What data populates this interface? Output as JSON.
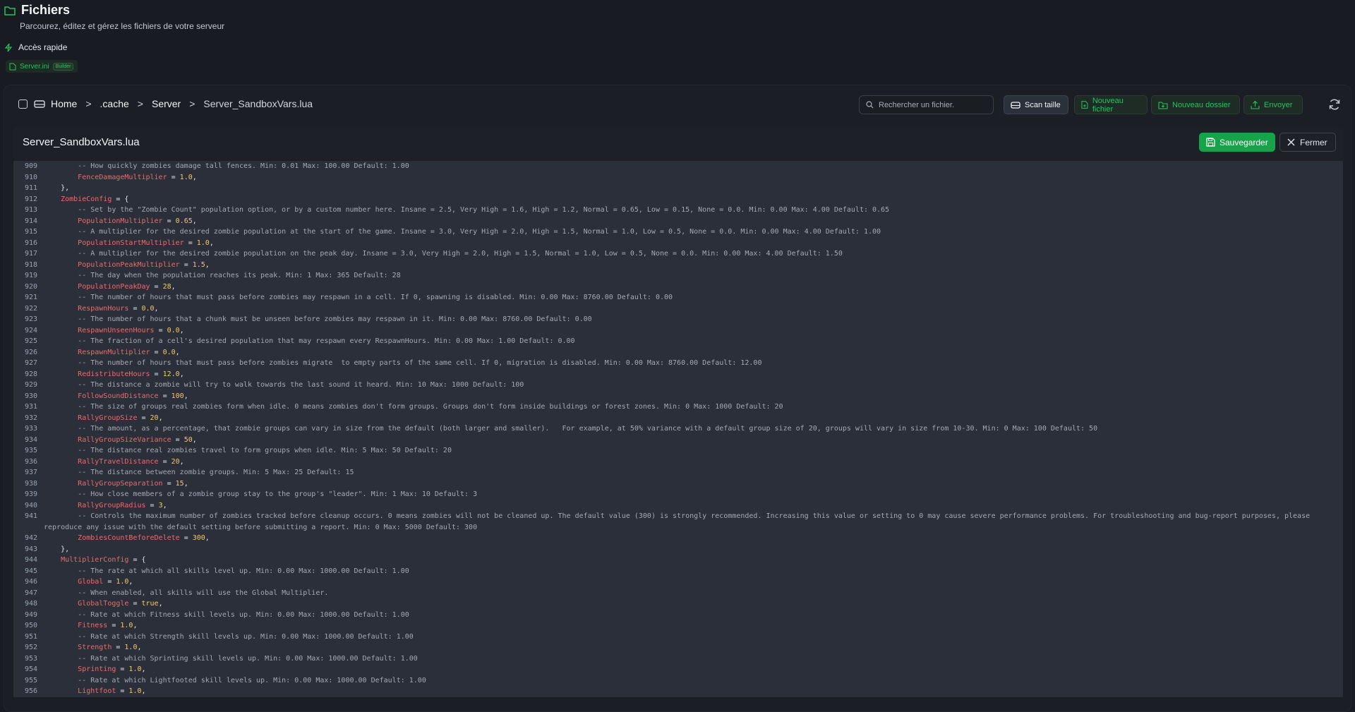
{
  "header": {
    "title": "Fichiers",
    "subtitle": "Parcourez, éditez et gérez les fichiers de votre serveur",
    "quick_access_label": "Accès rapide",
    "quick_chip": {
      "label": "Server.ini",
      "tag": "Builder"
    }
  },
  "breadcrumb": [
    "Home",
    ".cache",
    "Server",
    "Server_SandboxVars.lua"
  ],
  "breadcrumb_sep": ">",
  "search": {
    "placeholder": "Rechercher un fichier."
  },
  "toolbar": {
    "scan_label": "Scan taille",
    "new_file_label": "Nouveau fichier",
    "new_folder_label": "Nouveau dossier",
    "upload_label": "Envoyer"
  },
  "editor": {
    "filename": "Server_SandboxVars.lua",
    "save_label": "Sauvegarder",
    "close_label": "Fermer"
  },
  "colors": {
    "accent": "#22c55e",
    "save": "#16a34a",
    "key": "#ef6a6a",
    "number": "#f3c969"
  },
  "code_lines": [
    {
      "n": "909",
      "t": "comment",
      "indent": 8,
      "text": "-- How quickly zombies damage tall fences. Min: 0.01 Max: 100.00 Default: 1.00"
    },
    {
      "n": "910",
      "t": "assign",
      "indent": 8,
      "key": "FenceDamageMultiplier",
      "val": "1.0"
    },
    {
      "n": "911",
      "t": "plain",
      "indent": 4,
      "text": "},"
    },
    {
      "n": "912",
      "t": "open",
      "indent": 4,
      "key": "ZombieConfig"
    },
    {
      "n": "913",
      "t": "comment",
      "indent": 8,
      "text": "-- Set by the \"Zombie Count\" population option, or by a custom number here. Insane = 2.5, Very High = 1.6, High = 1.2, Normal = 0.65, Low = 0.15, None = 0.0. Min: 0.00 Max: 4.00 Default: 0.65"
    },
    {
      "n": "914",
      "t": "assign",
      "indent": 8,
      "key": "PopulationMultiplier",
      "val": "0.65"
    },
    {
      "n": "915",
      "t": "comment",
      "indent": 8,
      "text": "-- A multiplier for the desired zombie population at the start of the game. Insane = 3.0, Very High = 2.0, High = 1.5, Normal = 1.0, Low = 0.5, None = 0.0. Min: 0.00 Max: 4.00 Default: 1.00"
    },
    {
      "n": "916",
      "t": "assign",
      "indent": 8,
      "key": "PopulationStartMultiplier",
      "val": "1.0"
    },
    {
      "n": "917",
      "t": "comment",
      "indent": 8,
      "text": "-- A multiplier for the desired zombie population on the peak day. Insane = 3.0, Very High = 2.0, High = 1.5, Normal = 1.0, Low = 0.5, None = 0.0. Min: 0.00 Max: 4.00 Default: 1.50"
    },
    {
      "n": "918",
      "t": "assign",
      "indent": 8,
      "key": "PopulationPeakMultiplier",
      "val": "1.5"
    },
    {
      "n": "919",
      "t": "comment",
      "indent": 8,
      "text": "-- The day when the population reaches its peak. Min: 1 Max: 365 Default: 28"
    },
    {
      "n": "920",
      "t": "assign",
      "indent": 8,
      "key": "PopulationPeakDay",
      "val": "28"
    },
    {
      "n": "921",
      "t": "comment",
      "indent": 8,
      "text": "-- The number of hours that must pass before zombies may respawn in a cell. If 0, spawning is disabled. Min: 0.00 Max: 8760.00 Default: 0.00"
    },
    {
      "n": "922",
      "t": "assign",
      "indent": 8,
      "key": "RespawnHours",
      "val": "0.0"
    },
    {
      "n": "923",
      "t": "comment",
      "indent": 8,
      "text": "-- The number of hours that a chunk must be unseen before zombies may respawn in it. Min: 0.00 Max: 8760.00 Default: 0.00"
    },
    {
      "n": "924",
      "t": "assign",
      "indent": 8,
      "key": "RespawnUnseenHours",
      "val": "0.0"
    },
    {
      "n": "925",
      "t": "comment",
      "indent": 8,
      "text": "-- The fraction of a cell's desired population that may respawn every RespawnHours. Min: 0.00 Max: 1.00 Default: 0.00"
    },
    {
      "n": "926",
      "t": "assign",
      "indent": 8,
      "key": "RespawnMultiplier",
      "val": "0.0"
    },
    {
      "n": "927",
      "t": "comment",
      "indent": 8,
      "text": "-- The number of hours that must pass before zombies migrate  to empty parts of the same cell. If 0, migration is disabled. Min: 0.00 Max: 8760.00 Default: 12.00"
    },
    {
      "n": "928",
      "t": "assign",
      "indent": 8,
      "key": "RedistributeHours",
      "val": "12.0"
    },
    {
      "n": "929",
      "t": "comment",
      "indent": 8,
      "text": "-- The distance a zombie will try to walk towards the last sound it heard. Min: 10 Max: 1000 Default: 100"
    },
    {
      "n": "930",
      "t": "assign",
      "indent": 8,
      "key": "FollowSoundDistance",
      "val": "100"
    },
    {
      "n": "931",
      "t": "comment",
      "indent": 8,
      "text": "-- The size of groups real zombies form when idle. 0 means zombies don't form groups. Groups don't form inside buildings or forest zones. Min: 0 Max: 1000 Default: 20"
    },
    {
      "n": "932",
      "t": "assign",
      "indent": 8,
      "key": "RallyGroupSize",
      "val": "20"
    },
    {
      "n": "933",
      "t": "comment",
      "indent": 8,
      "text": "-- The amount, as a percentage, that zombie groups can vary in size from the default (both larger and smaller).   For example, at 50% variance with a default group size of 20, groups will vary in size from 10-30. Min: 0 Max: 100 Default: 50"
    },
    {
      "n": "934",
      "t": "assign",
      "indent": 8,
      "key": "RallyGroupSizeVariance",
      "val": "50"
    },
    {
      "n": "935",
      "t": "comment",
      "indent": 8,
      "text": "-- The distance real zombies travel to form groups when idle. Min: 5 Max: 50 Default: 20"
    },
    {
      "n": "936",
      "t": "assign",
      "indent": 8,
      "key": "RallyTravelDistance",
      "val": "20"
    },
    {
      "n": "937",
      "t": "comment",
      "indent": 8,
      "text": "-- The distance between zombie groups. Min: 5 Max: 25 Default: 15"
    },
    {
      "n": "938",
      "t": "assign",
      "indent": 8,
      "key": "RallyGroupSeparation",
      "val": "15"
    },
    {
      "n": "939",
      "t": "comment",
      "indent": 8,
      "text": "-- How close members of a zombie group stay to the group's \"leader\". Min: 1 Max: 10 Default: 3"
    },
    {
      "n": "940",
      "t": "assign",
      "indent": 8,
      "key": "RallyGroupRadius",
      "val": "3"
    },
    {
      "n": "941",
      "t": "comment",
      "indent": 8,
      "wrap": true,
      "text": "-- Controls the maximum number of zombies tracked before cleanup occurs. 0 means zombies will not be cleaned up. The default value (300) is strongly recommended. Increasing this value or setting to 0 may cause severe performance problems. For troubleshooting and bug-report purposes, please reproduce any issue with the default setting before submitting a report. Min: 0 Max: 5000 Default: 300"
    },
    {
      "n": "942",
      "t": "assign",
      "indent": 8,
      "key": "ZombiesCountBeforeDelete",
      "val": "300"
    },
    {
      "n": "943",
      "t": "plain",
      "indent": 4,
      "text": "},"
    },
    {
      "n": "944",
      "t": "open",
      "indent": 4,
      "key": "MultiplierConfig"
    },
    {
      "n": "945",
      "t": "comment",
      "indent": 8,
      "text": "-- The rate at which all skills level up. Min: 0.00 Max: 1000.00 Default: 1.00"
    },
    {
      "n": "946",
      "t": "assign",
      "indent": 8,
      "key": "Global",
      "val": "1.0"
    },
    {
      "n": "947",
      "t": "comment",
      "indent": 8,
      "text": "-- When enabled, all skills will use the Global Multiplier."
    },
    {
      "n": "948",
      "t": "assign",
      "indent": 8,
      "key": "GlobalToggle",
      "val": "true"
    },
    {
      "n": "949",
      "t": "comment",
      "indent": 8,
      "text": "-- Rate at which Fitness skill levels up. Min: 0.00 Max: 1000.00 Default: 1.00"
    },
    {
      "n": "950",
      "t": "assign",
      "indent": 8,
      "key": "Fitness",
      "val": "1.0"
    },
    {
      "n": "951",
      "t": "comment",
      "indent": 8,
      "text": "-- Rate at which Strength skill levels up. Min: 0.00 Max: 1000.00 Default: 1.00"
    },
    {
      "n": "952",
      "t": "assign",
      "indent": 8,
      "key": "Strength",
      "val": "1.0"
    },
    {
      "n": "953",
      "t": "comment",
      "indent": 8,
      "text": "-- Rate at which Sprinting skill levels up. Min: 0.00 Max: 1000.00 Default: 1.00"
    },
    {
      "n": "954",
      "t": "assign",
      "indent": 8,
      "key": "Sprinting",
      "val": "1.0"
    },
    {
      "n": "955",
      "t": "comment",
      "indent": 8,
      "text": "-- Rate at which Lightfooted skill levels up. Min: 0.00 Max: 1000.00 Default: 1.00"
    },
    {
      "n": "956",
      "t": "assign",
      "indent": 8,
      "key": "Lightfoot",
      "val": "1.0"
    }
  ]
}
